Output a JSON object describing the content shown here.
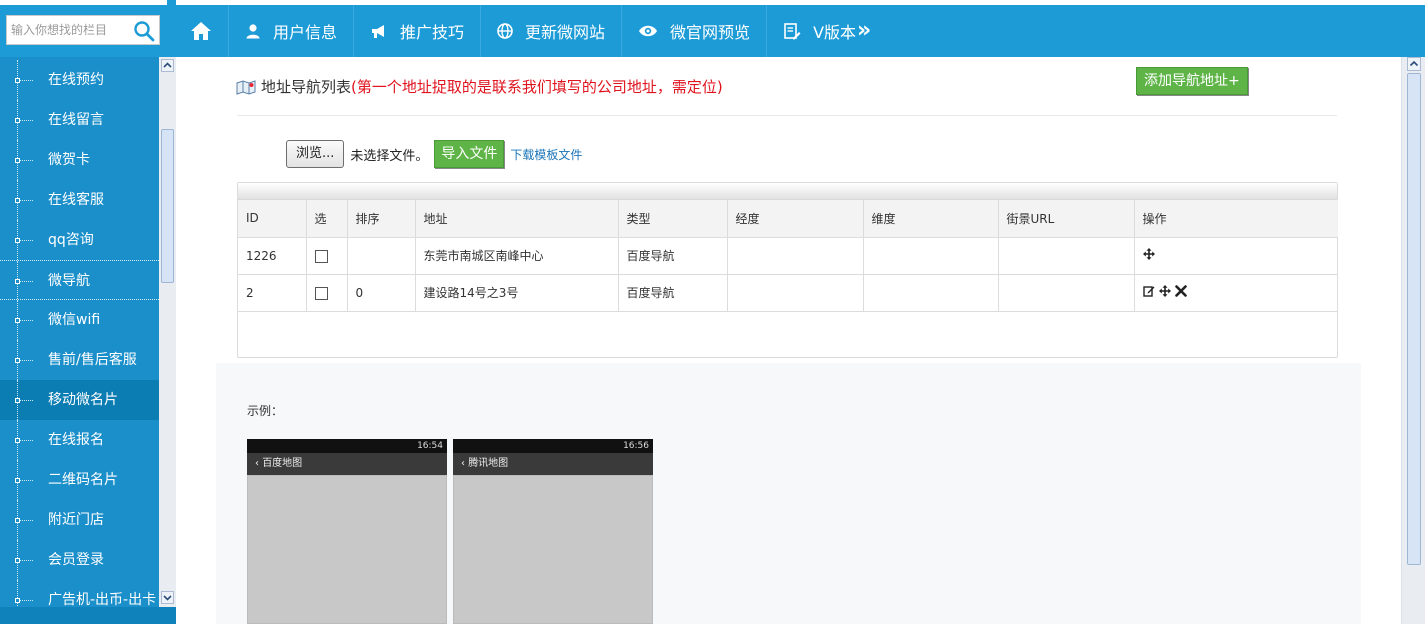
{
  "search": {
    "placeholder": "输入你想找的栏目"
  },
  "nav": [
    {
      "label": "",
      "icon": "home-icon"
    },
    {
      "label": "用户信息",
      "icon": "user-icon"
    },
    {
      "label": "推广技巧",
      "icon": "megaphone-icon"
    },
    {
      "label": "更新微网站",
      "icon": "globe-icon"
    },
    {
      "label": "微官网预览",
      "icon": "eye-icon"
    },
    {
      "label": "V版本",
      "icon": "edit-doc-icon",
      "suffix": "»"
    }
  ],
  "sidebar": {
    "items": [
      {
        "label": "在线预约"
      },
      {
        "label": "在线留言"
      },
      {
        "label": "微贺卡"
      },
      {
        "label": "在线客服"
      },
      {
        "label": "qq咨询"
      },
      {
        "label": "微导航",
        "active": true
      },
      {
        "label": "微信wifi"
      },
      {
        "label": "售前/售后客服"
      },
      {
        "label": "移动微名片",
        "highlight": true
      },
      {
        "label": "在线报名"
      },
      {
        "label": "二维码名片"
      },
      {
        "label": "附近门店"
      },
      {
        "label": "会员登录"
      },
      {
        "label": "广告机-出币-出卡"
      }
    ]
  },
  "header": {
    "title": "地址导航列表",
    "warning": "(第一个地址捉取的是联系我们填写的公司地址，需定位)",
    "add_button": "添加导航地址+"
  },
  "file_upload": {
    "browse_label": "浏览...",
    "no_file_text": "未选择文件。",
    "import_label": "导入文件",
    "download_template_label": "下载模板文件"
  },
  "table": {
    "columns": [
      "ID",
      "选",
      "排序",
      "地址",
      "类型",
      "经度",
      "维度",
      "街景URL",
      "操作"
    ],
    "rows": [
      {
        "id": "1226",
        "sort": "",
        "address": "东莞市南城区南峰中心",
        "type": "百度导航",
        "lng": "",
        "lat": "",
        "street_url": "",
        "ops": [
          "move-icon"
        ]
      },
      {
        "id": "2",
        "sort": "0",
        "address": "建设路14号之3号",
        "type": "百度导航",
        "lng": "",
        "lat": "",
        "street_url": "",
        "ops": [
          "edit-icon",
          "move-icon",
          "delete-icon"
        ]
      }
    ]
  },
  "example": {
    "label": "示例：",
    "screens": [
      {
        "app_title": "百度地图",
        "time": "16:54"
      },
      {
        "app_title": "腾讯地图",
        "time": "16:56"
      }
    ]
  },
  "colors": {
    "topbar": "#1c9bd7",
    "sidebar": "#1b8fca",
    "green_button": "#5fb448",
    "warning_text": "#e0141e"
  }
}
